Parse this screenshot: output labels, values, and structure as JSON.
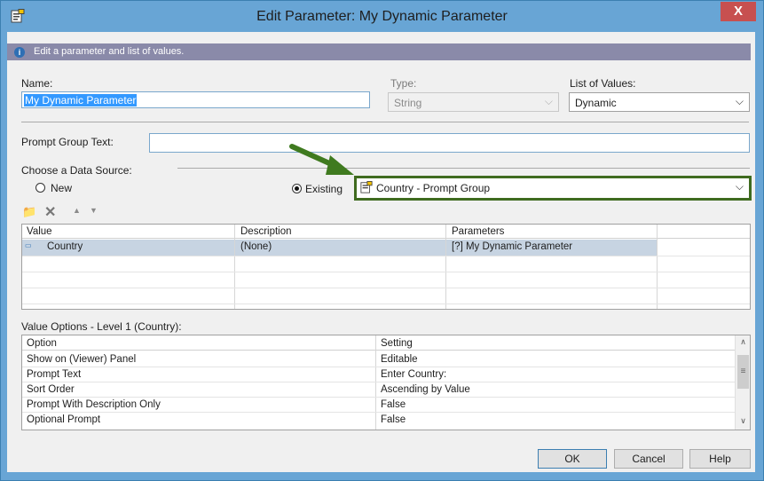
{
  "window": {
    "title": "Edit Parameter: My Dynamic Parameter",
    "close_label": "X"
  },
  "info": {
    "text": "Edit a parameter and list of values.",
    "icon": "info-icon"
  },
  "name": {
    "label": "Name:",
    "value": "My Dynamic Parameter"
  },
  "type": {
    "label": "Type:",
    "value": "String"
  },
  "list_of_values": {
    "label": "List of Values:",
    "value": "Dynamic"
  },
  "prompt_group_text": {
    "label": "Prompt Group Text:",
    "value": ""
  },
  "data_source": {
    "label": "Choose a Data Source:",
    "new_label": "New",
    "existing_label": "Existing",
    "selected": "existing",
    "existing_value": "Country - Prompt Group"
  },
  "annotation": {
    "arrow_color": "#3f7a1f",
    "highlight_color": "#3f6b1f"
  },
  "toolbar": {
    "icons": [
      "new-icon",
      "delete-icon",
      "move-up-icon",
      "move-down-icon"
    ]
  },
  "values_table": {
    "headers": [
      "Value",
      "Description",
      "Parameters"
    ],
    "rows": [
      {
        "value": "Country",
        "description": "(None)",
        "parameters": "[?]  My Dynamic Parameter"
      }
    ]
  },
  "options": {
    "label": "Value Options - Level 1 (Country):",
    "headers": [
      "Option",
      "Setting"
    ],
    "rows": [
      {
        "option": "Show on (Viewer) Panel",
        "setting": "Editable"
      },
      {
        "option": "Prompt Text",
        "setting": "Enter Country:"
      },
      {
        "option": "Sort Order",
        "setting": "Ascending by Value"
      },
      {
        "option": "Prompt With Description Only",
        "setting": "False"
      },
      {
        "option": "Optional Prompt",
        "setting": "False"
      }
    ]
  },
  "buttons": {
    "ok": "OK",
    "cancel": "Cancel",
    "help": "Help"
  }
}
